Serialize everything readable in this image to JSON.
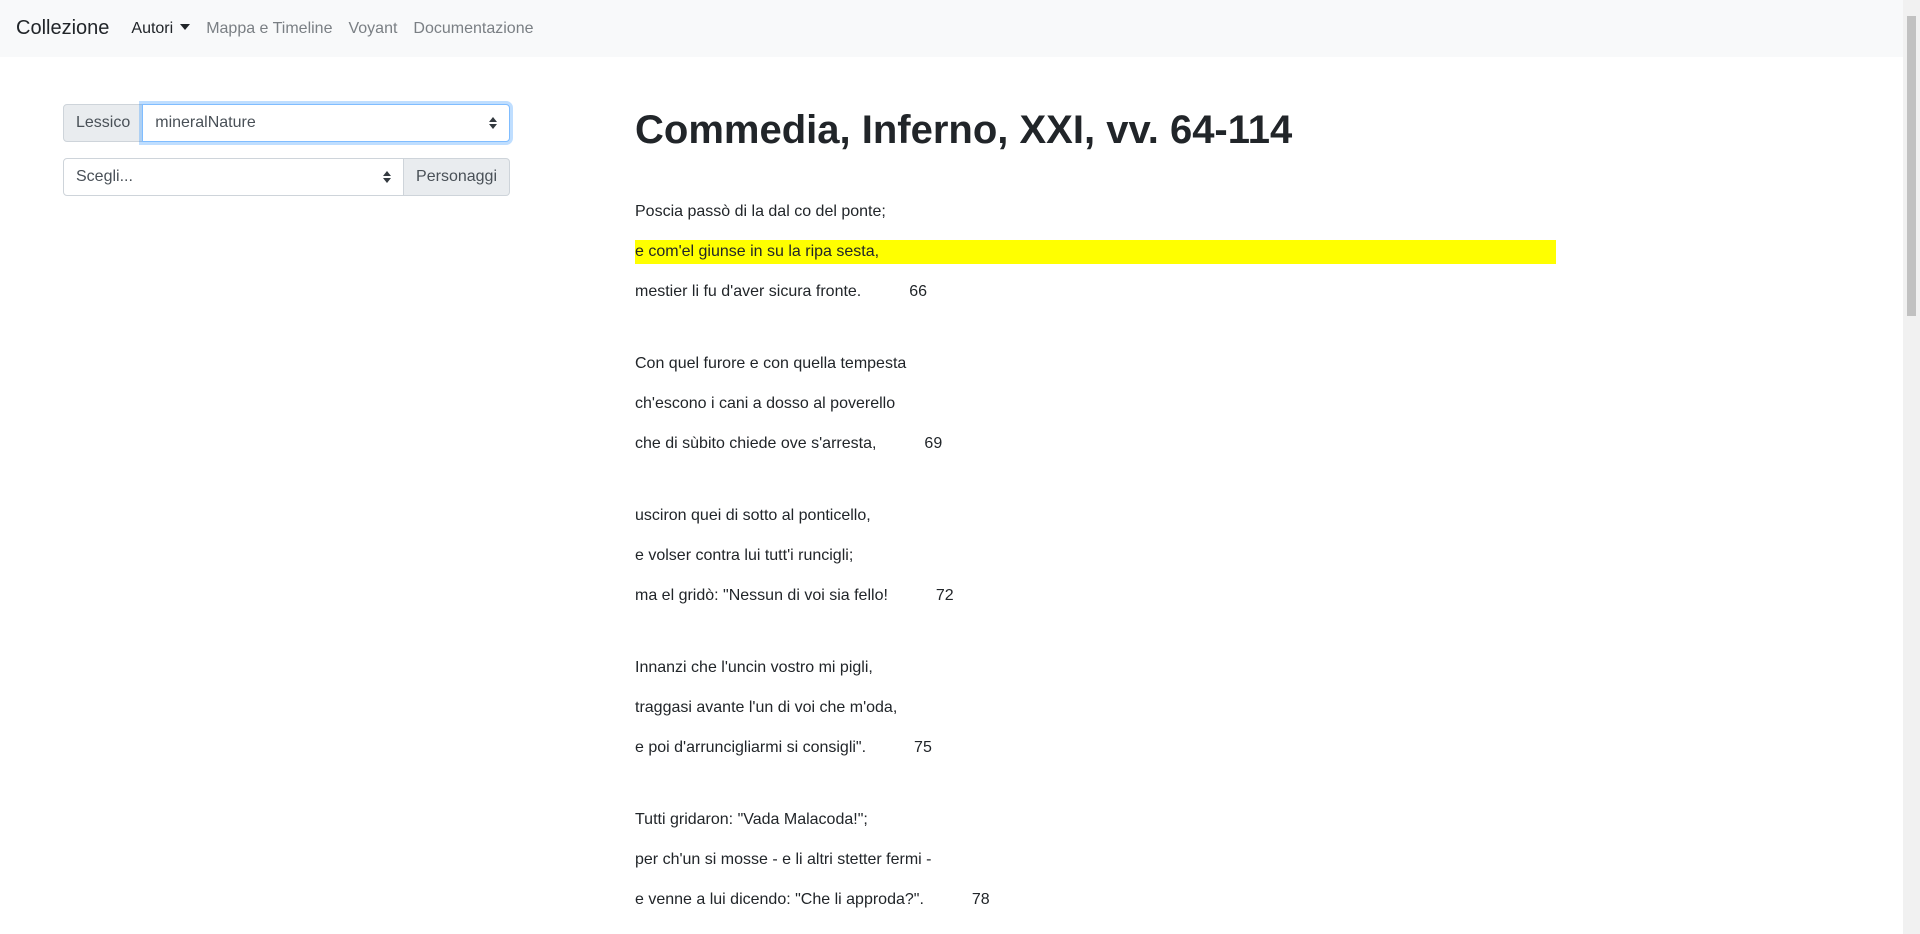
{
  "navbar": {
    "brand": "Collezione",
    "items": [
      {
        "label": "Autori"
      },
      {
        "label": "Mappa e Timeline"
      },
      {
        "label": "Voyant"
      },
      {
        "label": "Documentazione"
      }
    ]
  },
  "left_panel": {
    "lessico_label": "Lessico",
    "lessico_selected": "mineralNature",
    "personaggi_selected": "Scegli...",
    "personaggi_label": "Personaggi"
  },
  "main": {
    "title": "Commedia, Inferno, XXI, vv. 64-114",
    "stanzas": [
      {
        "lines": [
          {
            "text": "Poscia passò di la dal co del ponte;",
            "num": ""
          },
          {
            "text": "e com'el giunse in su la ripa sesta,",
            "num": ""
          },
          {
            "text": "mestier li fu d'aver sicura fronte.",
            "num": "66"
          }
        ]
      },
      {
        "lines": [
          {
            "text": "Con quel furore e con quella tempesta",
            "num": ""
          },
          {
            "text": "ch'escono i cani a dosso al poverello",
            "num": ""
          },
          {
            "text": "che di sùbito chiede ove s'arresta,",
            "num": "69"
          }
        ]
      },
      {
        "lines": [
          {
            "text": "usciron quei di sotto al ponticello,",
            "num": ""
          },
          {
            "text": "e volser contra lui tutt'i runcigli;",
            "num": ""
          },
          {
            "text": "ma el gridò: \"Nessun di voi sia fello!",
            "num": "72"
          }
        ]
      },
      {
        "lines": [
          {
            "text": "Innanzi che l'uncin vostro mi pigli,",
            "num": ""
          },
          {
            "text": "traggasi avante l'un di voi che m'oda,",
            "num": ""
          },
          {
            "text": "e poi d'arruncigliarmi si consigli\".",
            "num": "75"
          }
        ]
      },
      {
        "lines": [
          {
            "text": "Tutti gridaron: \"Vada Malacoda!\";",
            "num": ""
          },
          {
            "text": "per ch'un si mosse - e li altri stetter fermi -",
            "num": ""
          },
          {
            "text": "e venne a lui dicendo: \"Che li approda?\".",
            "num": "78"
          }
        ]
      }
    ],
    "highlight_color": "#ffff00"
  }
}
